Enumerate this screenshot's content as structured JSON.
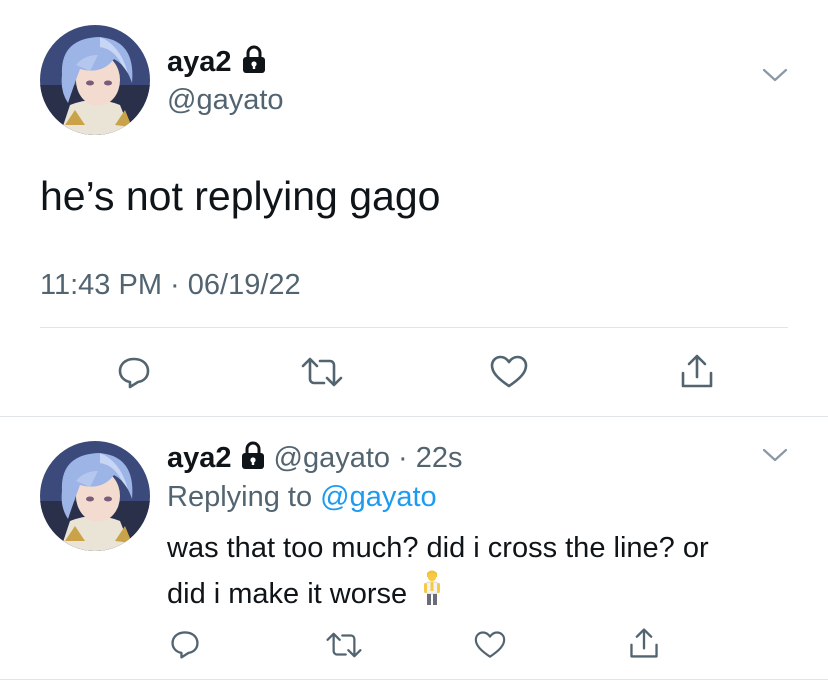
{
  "tweet": {
    "display_name": "aya2",
    "handle": "@gayato",
    "text": "he’s not replying gago",
    "time": "11:43 PM",
    "separator": "·",
    "date": "06/19/22"
  },
  "reply": {
    "display_name": "aya2",
    "handle": "@gayato",
    "separator": "·",
    "age": "22s",
    "replying_prefix": "Replying to",
    "replying_to": "@gayato",
    "text_line1": "was that too much? did i cross the line? or",
    "text_line2": "did i make it worse"
  },
  "icons": {
    "lock": "lock-icon",
    "chevron": "chevron-down-icon",
    "reply": "reply-icon",
    "retweet": "retweet-icon",
    "like": "heart-icon",
    "share": "share-icon",
    "emoji": "person-standing-emoji"
  },
  "colors": {
    "text": "#0f1419",
    "secondary": "#536471",
    "link": "#1d9bf0",
    "divider": "#e1e5e8"
  }
}
